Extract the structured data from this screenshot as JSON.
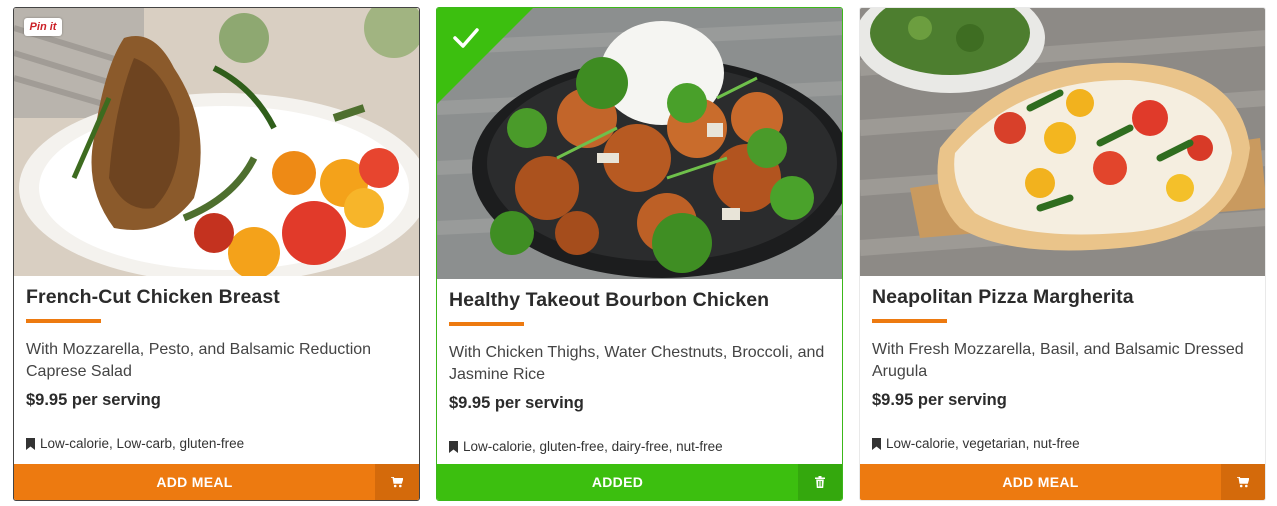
{
  "colors": {
    "accent": "#ed7a10",
    "accent_dark": "#d46a0b",
    "added": "#3cbf0f",
    "added_dark": "#34a80d"
  },
  "cards": [
    {
      "title": "French-Cut Chicken Breast",
      "description": "With Mozzarella, Pesto, and Balsamic Reduction Caprese Salad",
      "price": "$9.95 per serving",
      "tags": "Low-calorie, Low-carb, gluten-free",
      "action_label": "ADD MEAL",
      "action_icon": "cart-icon",
      "pin_label": "Pin it"
    },
    {
      "title": "Healthy Takeout Bourbon Chicken",
      "description": "With Chicken Thighs, Water Chestnuts, Broccoli, and Jasmine Rice",
      "price": "$9.95 per serving",
      "tags": "Low-calorie, gluten-free, dairy-free, nut-free",
      "action_label": "ADDED",
      "action_icon": "trash-icon",
      "selected": true
    },
    {
      "title": "Neapolitan Pizza Margherita",
      "description": "With Fresh Mozzarella, Basil, and Balsamic Dressed Arugula",
      "price": "$9.95 per serving",
      "tags": "Low-calorie, vegetarian, nut-free",
      "action_label": "ADD MEAL",
      "action_icon": "cart-icon"
    }
  ]
}
